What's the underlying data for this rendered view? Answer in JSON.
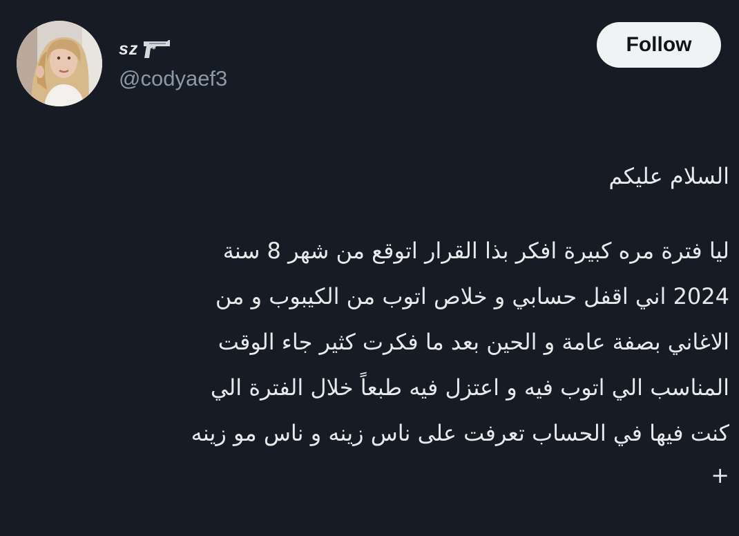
{
  "author": {
    "display_name": "sz",
    "handle": "@codyaef3",
    "avatar_icon": "avatar-photo",
    "name_emoji_icon": "pistol-icon"
  },
  "follow_button": {
    "label": "Follow"
  },
  "tweet": {
    "greeting": "السلام عليكم",
    "lines": [
      "ليا فترة مره كبيرة افكر بذا القرار اتوقع من شهر 8 سنة",
      "2024 اني اقفل حسابي و خلاص اتوب من الكيبوب و من",
      "الاغاني بصفة عامة و الحين بعد ما فكرت كثير جاء الوقت",
      "المناسب الي اتوب فيه و اعتزل فيه طبعاً خلال الفترة الي",
      "كنت فيها في الحساب تعرفت على ناس زينه و ناس مو زينه"
    ],
    "continuation": "+"
  },
  "colors": {
    "background": "#161b24",
    "text": "#e7e9ea",
    "secondary_text": "#8b98a5",
    "button_bg": "#eff3f4",
    "button_text": "#0f1419"
  }
}
